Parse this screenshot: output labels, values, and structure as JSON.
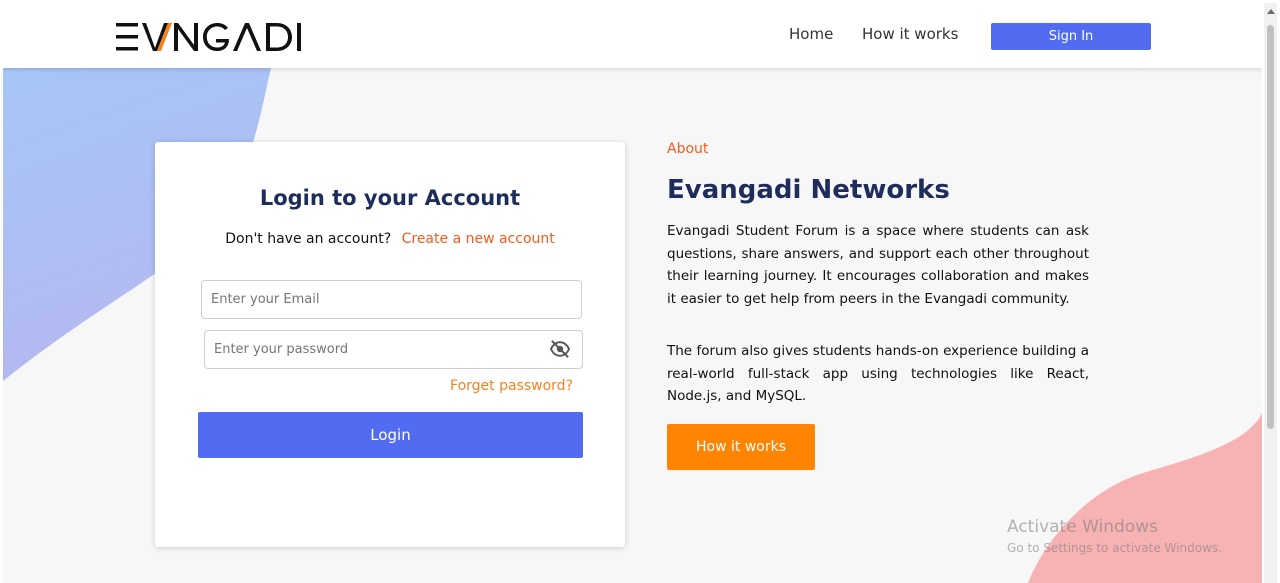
{
  "header": {
    "logo_text": "EVANGADI",
    "nav": [
      {
        "label": "Home"
      },
      {
        "label": "How it works"
      }
    ],
    "sign_in_label": "Sign In"
  },
  "login": {
    "title": "Login to your Account",
    "no_account_text": "Don't have an account?",
    "create_account_link": "Create a new account",
    "email_placeholder": "Enter your Email",
    "password_placeholder": "Enter your password",
    "forgot_password": "Forget password?",
    "login_button": "Login",
    "password_toggle_icon": "eye-slash-icon"
  },
  "about": {
    "label": "About",
    "title": "Evangadi Networks",
    "paragraph1": "Evangadi Student Forum is a space where students can ask questions, share answers, and support each other throughout their learning journey. It encourages collaboration and makes it easier to get help from peers in the Evangadi community.",
    "paragraph2": "The forum also gives students hands-on experience building a real-world full-stack app using technologies like React, Node.js, and MySQL.",
    "how_button": "How it works"
  },
  "watermark": {
    "line1": "Activate Windows",
    "line2": "Go to Settings to activate Windows."
  },
  "colors": {
    "primary_blue": "#516cf0",
    "accent_orange": "#fe8402",
    "link_orange": "#f55b1e",
    "title_navy": "#1f2d5c",
    "blob_blue": "#a9c4f5",
    "blob_pink": "#f7b3b3"
  }
}
